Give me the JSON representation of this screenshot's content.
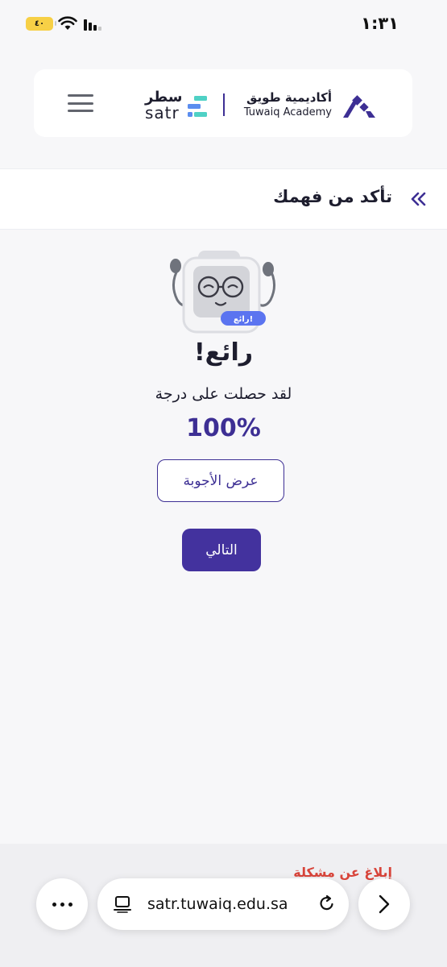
{
  "status_bar": {
    "battery": "٤٠",
    "time": "١:٣١"
  },
  "header": {
    "satr_logo": {
      "arabic": "سطر",
      "latin": "satr"
    },
    "tuwaiq_logo": {
      "arabic": "أكاديمية طويق",
      "latin": "Tuwaiq Academy"
    },
    "menu_icon": "hamburger-icon"
  },
  "section": {
    "title": "تأكد من فهمك",
    "icon": "double-chevron-icon"
  },
  "result": {
    "badge": "رائع!",
    "title": "رائع!",
    "subtitle": "لقد حصلت على درجة",
    "score": "100%"
  },
  "buttons": {
    "show_answers": "عرض الأجوبة",
    "next": "التالي"
  },
  "footer": {
    "report": "إبلاغ عن مشكلة"
  },
  "browser": {
    "url": "satr.tuwaiq.edu.sa"
  },
  "colors": {
    "primary": "#43329e",
    "danger": "#d8443a",
    "accent_blue": "#5b74f0",
    "teal": "#4fd1c5"
  }
}
